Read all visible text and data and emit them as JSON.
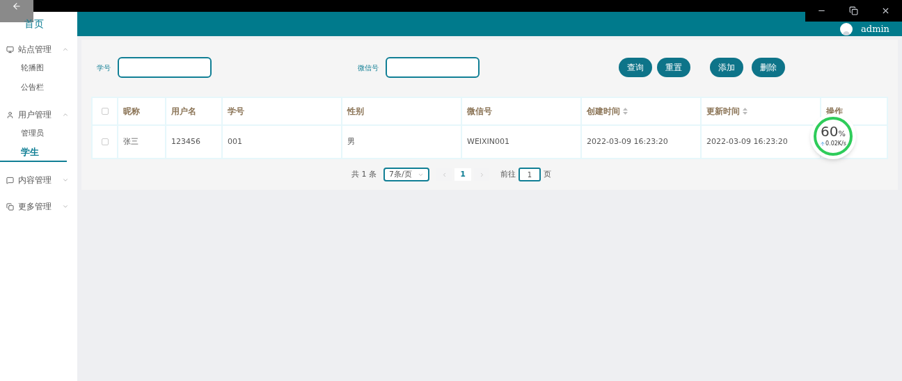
{
  "header": {
    "user": "admin"
  },
  "sidebar": {
    "home": "首页",
    "groups": [
      {
        "label": "站点管理",
        "expanded": true,
        "children": [
          {
            "label": "轮播图",
            "selected": false
          },
          {
            "label": "公告栏",
            "selected": false
          }
        ]
      },
      {
        "label": "用户管理",
        "expanded": true,
        "children": [
          {
            "label": "管理员",
            "selected": false
          },
          {
            "label": "学生",
            "selected": true
          }
        ]
      },
      {
        "label": "内容管理",
        "expanded": false
      },
      {
        "label": "更多管理",
        "expanded": false
      }
    ]
  },
  "search": {
    "fields": [
      {
        "label": "学号"
      },
      {
        "label": "微信号"
      }
    ],
    "buttons": [
      "查询",
      "重置"
    ],
    "actions": [
      "添加",
      "删除"
    ]
  },
  "table": {
    "all_checked": false,
    "columns": [
      {
        "label": "昵称",
        "sortable": false
      },
      {
        "label": "用户名",
        "sortable": false
      },
      {
        "label": "学号",
        "sortable": false
      },
      {
        "label": "性别",
        "sortable": false
      },
      {
        "label": "微信号",
        "sortable": false
      },
      {
        "label": "创建时间",
        "sortable": true
      },
      {
        "label": "更新时间",
        "sortable": true
      },
      {
        "label": "操作",
        "sortable": false
      }
    ],
    "rows": [
      {
        "checked": false,
        "cells": [
          "张三",
          "123456",
          "001",
          "男",
          "WEIXIN001",
          "2022-03-09 16:23:20",
          "2022-03-09 16:23:20"
        ]
      }
    ]
  },
  "pagination": {
    "total": "共 1 条",
    "page_size": "7条/页",
    "pages": [
      {
        "label": "1",
        "selected": true
      }
    ],
    "goto_label": "前往",
    "goto_value": "1",
    "goto_suffix": "页"
  },
  "speed_widget": {
    "percent": "60",
    "unit": "%",
    "speed": "0.02K/s"
  }
}
